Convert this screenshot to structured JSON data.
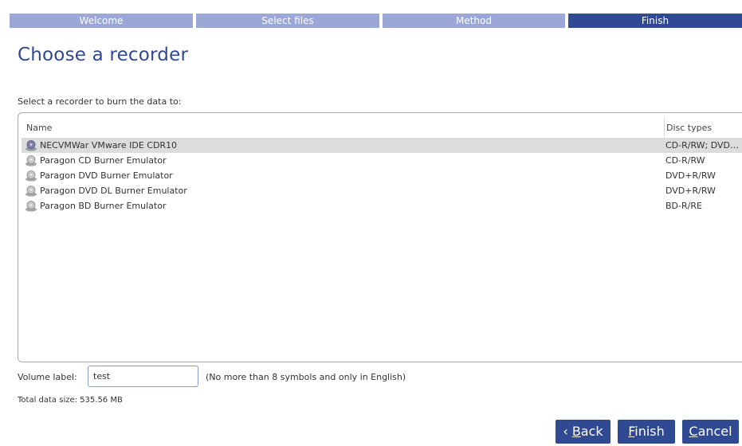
{
  "wizard_steps": [
    {
      "label": "Welcome",
      "active": false
    },
    {
      "label": "Select files",
      "active": false
    },
    {
      "label": "Method",
      "active": false
    },
    {
      "label": "Finish",
      "active": true
    }
  ],
  "page_title": "Choose a recorder",
  "prompt": "Select a recorder to burn the data to:",
  "recorder_list": {
    "columns": {
      "name": "Name",
      "disc_types": "Disc types"
    },
    "rows": [
      {
        "name": "NECVMWar VMware IDE CDR10",
        "disc_types": "CD-R/RW; DVD+R/RW",
        "selected": true,
        "icon": "optical-drive-icon"
      },
      {
        "name": "Paragon CD Burner Emulator",
        "disc_types": "CD-R/RW",
        "selected": false,
        "icon": "optical-drive-icon"
      },
      {
        "name": "Paragon DVD Burner Emulator",
        "disc_types": "DVD+R/RW",
        "selected": false,
        "icon": "optical-drive-icon"
      },
      {
        "name": "Paragon DVD DL Burner Emulator",
        "disc_types": "DVD+R/RW",
        "selected": false,
        "icon": "optical-drive-icon"
      },
      {
        "name": "Paragon BD Burner Emulator",
        "disc_types": "BD-R/RE",
        "selected": false,
        "icon": "optical-drive-icon"
      }
    ]
  },
  "volume": {
    "label": "Volume label:",
    "value": "test",
    "hint": "(No more than 8 symbols and only in English)"
  },
  "total_size": "Total data size: 535.56 MB",
  "buttons": {
    "back": {
      "prefix": "‹ ",
      "mnemonic": "B",
      "rest": "ack"
    },
    "finish": {
      "mnemonic": "F",
      "rest": "inish"
    },
    "cancel": {
      "mnemonic": "C",
      "rest": "ancel"
    }
  },
  "colors": {
    "accent": "#2f4a93",
    "step_inactive": "#9ba7d6",
    "selection": "#dcdcdc"
  }
}
